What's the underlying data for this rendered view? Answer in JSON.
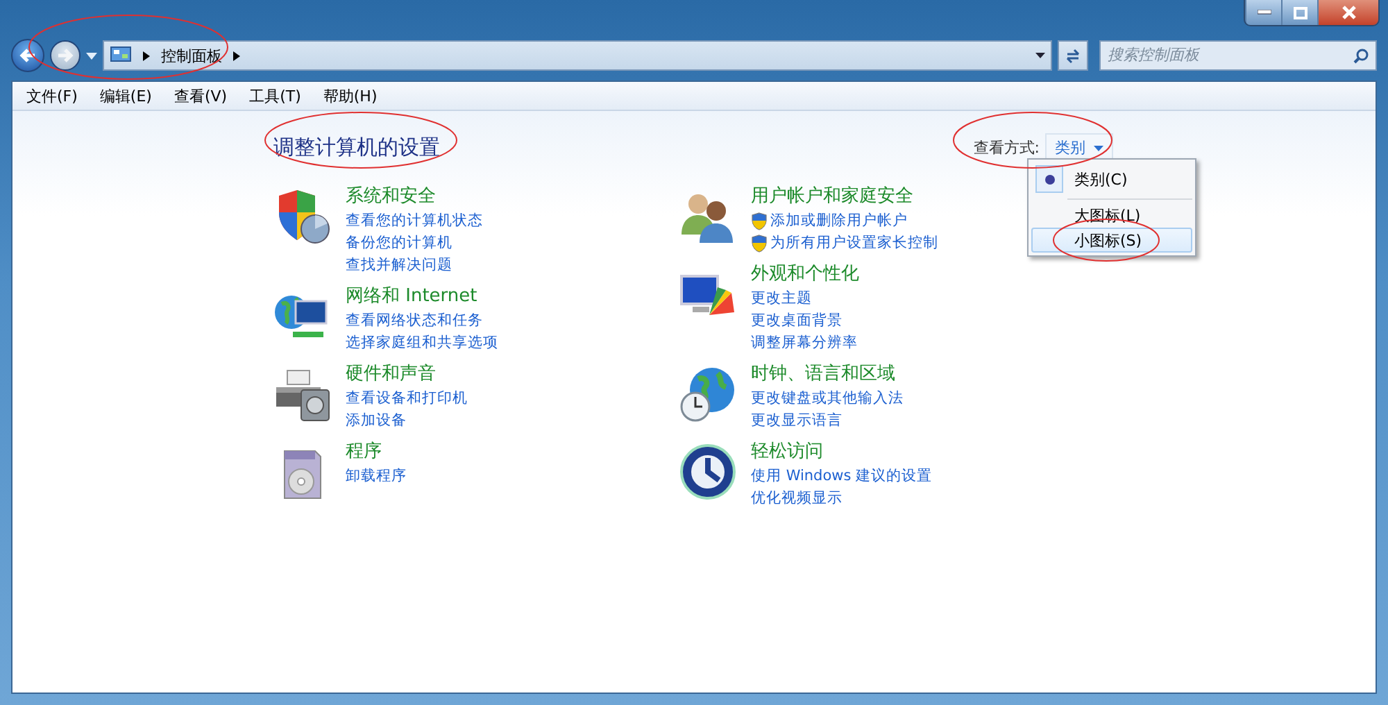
{
  "breadcrumb": [
    "控制面板"
  ],
  "search": {
    "placeholder": "搜索控制面板"
  },
  "menu": [
    "文件(F)",
    "编辑(E)",
    "查看(V)",
    "工具(T)",
    "帮助(H)"
  ],
  "heading": "调整计算机的设置",
  "view": {
    "label": "查看方式:",
    "value": "类别"
  },
  "view_menu": [
    {
      "label": "类别(C)",
      "selected": true,
      "highlighted": false
    },
    {
      "label": "大图标(L)",
      "selected": false,
      "highlighted": false
    },
    {
      "label": "小图标(S)",
      "selected": false,
      "highlighted": true
    }
  ],
  "columns": [
    [
      {
        "kind": "security",
        "title": "系统和安全",
        "links": [
          {
            "label": "查看您的计算机状态",
            "shield": false
          },
          {
            "label": "备份您的计算机",
            "shield": false
          },
          {
            "label": "查找并解决问题",
            "shield": false
          }
        ]
      },
      {
        "kind": "network",
        "title": "网络和 Internet",
        "links": [
          {
            "label": "查看网络状态和任务",
            "shield": false
          },
          {
            "label": "选择家庭组和共享选项",
            "shield": false
          }
        ]
      },
      {
        "kind": "hardware",
        "title": "硬件和声音",
        "links": [
          {
            "label": "查看设备和打印机",
            "shield": false
          },
          {
            "label": "添加设备",
            "shield": false
          }
        ]
      },
      {
        "kind": "programs",
        "title": "程序",
        "links": [
          {
            "label": "卸载程序",
            "shield": false
          }
        ]
      }
    ],
    [
      {
        "kind": "users",
        "title": "用户帐户和家庭安全",
        "links": [
          {
            "label": "添加或删除用户帐户",
            "shield": true
          },
          {
            "label": "为所有用户设置家长控制",
            "shield": true
          }
        ]
      },
      {
        "kind": "appearance",
        "title": "外观和个性化",
        "links": [
          {
            "label": "更改主题",
            "shield": false
          },
          {
            "label": "更改桌面背景",
            "shield": false
          },
          {
            "label": "调整屏幕分辨率",
            "shield": false
          }
        ]
      },
      {
        "kind": "clock",
        "title": "时钟、语言和区域",
        "links": [
          {
            "label": "更改键盘或其他输入法",
            "shield": false
          },
          {
            "label": "更改显示语言",
            "shield": false
          }
        ]
      },
      {
        "kind": "access",
        "title": "轻松访问",
        "links": [
          {
            "label": "使用 Windows 建议的设置",
            "shield": false
          },
          {
            "label": "优化视频显示",
            "shield": false
          }
        ]
      }
    ]
  ]
}
